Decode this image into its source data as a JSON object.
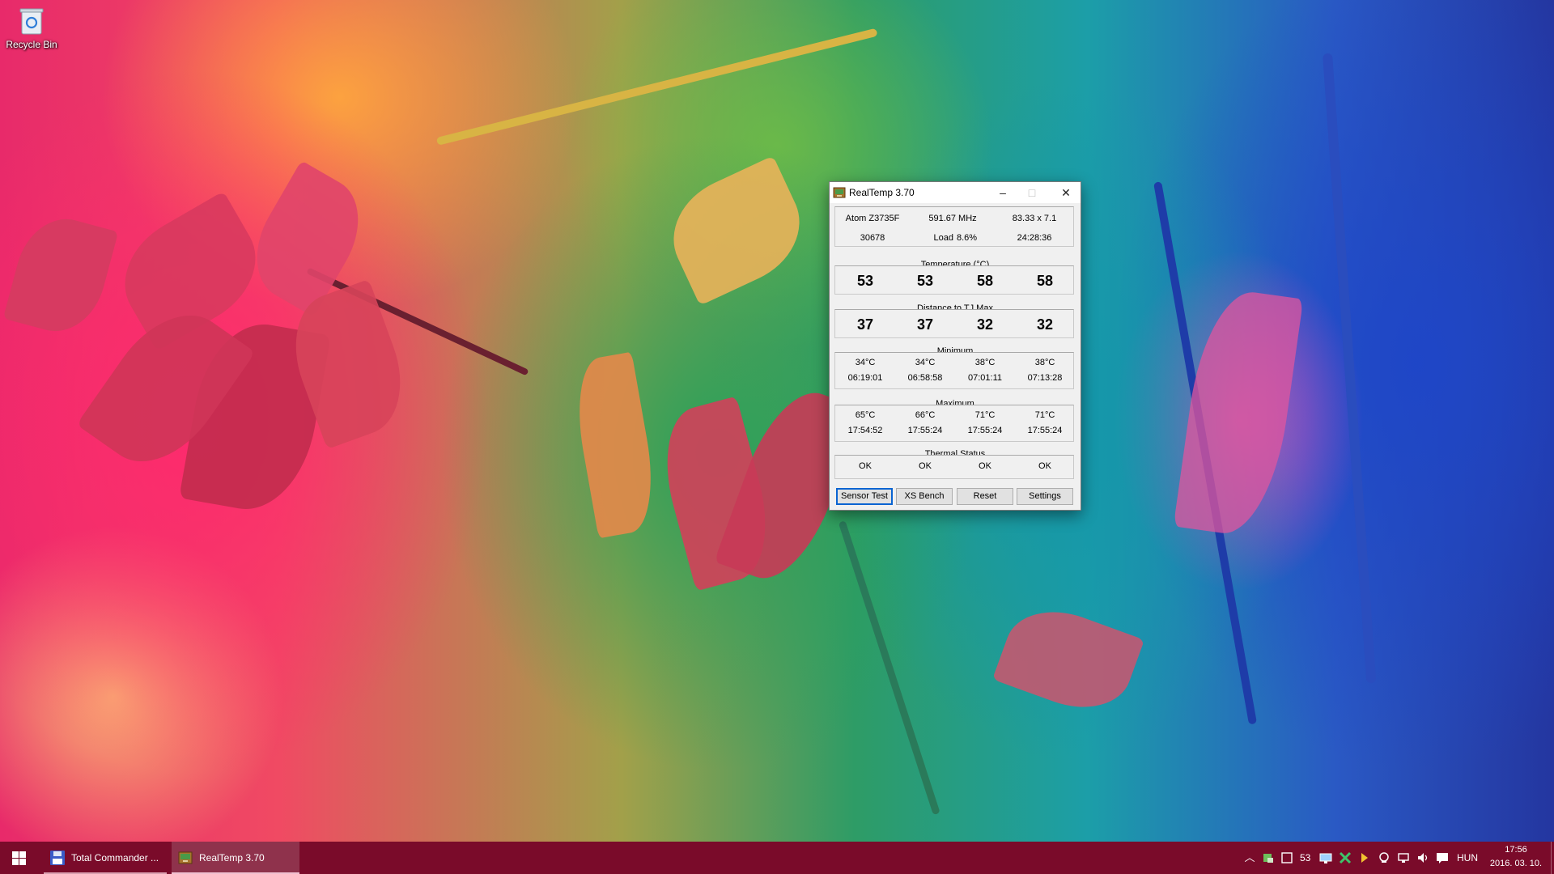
{
  "desktop": {
    "icons": [
      {
        "label": "Recycle Bin",
        "icon": "recycle-bin-icon"
      }
    ]
  },
  "window": {
    "title": "RealTemp 3.70",
    "controls": {
      "minimize": "–",
      "maximize": "□",
      "close": "✕"
    },
    "cpu": {
      "model": "Atom Z3735F",
      "frequency": "591.67 MHz",
      "multiplier": "83.33 x 7.1",
      "vid": "30678",
      "load_label": "Load",
      "load_value": "8.6%",
      "uptime": "24:28:36"
    },
    "temperature": {
      "title": "Temperature (°C)",
      "values": [
        "53",
        "53",
        "58",
        "58"
      ]
    },
    "distance": {
      "title": "Distance to TJ Max",
      "values": [
        "37",
        "37",
        "32",
        "32"
      ]
    },
    "minimum": {
      "title": "Minimum",
      "temps": [
        "34°C",
        "34°C",
        "38°C",
        "38°C"
      ],
      "times": [
        "06:19:01",
        "06:58:58",
        "07:01:11",
        "07:13:28"
      ]
    },
    "maximum": {
      "title": "Maximum",
      "temps": [
        "65°C",
        "66°C",
        "71°C",
        "71°C"
      ],
      "times": [
        "17:54:52",
        "17:55:24",
        "17:55:24",
        "17:55:24"
      ]
    },
    "thermal_status": {
      "title": "Thermal Status",
      "values": [
        "OK",
        "OK",
        "OK",
        "OK"
      ]
    },
    "buttons": {
      "sensor_test": "Sensor Test",
      "xs_bench": "XS Bench",
      "reset": "Reset",
      "settings": "Settings"
    }
  },
  "taskbar": {
    "items": [
      {
        "label": "Total Commander ...",
        "icon": "floppy-disk-icon"
      },
      {
        "label": "RealTemp 3.70",
        "icon": "realtemp-icon"
      }
    ],
    "tray": {
      "temp_readout": "53",
      "language": "HUN",
      "time": "17:56",
      "date": "2016. 03. 10."
    }
  },
  "colors": {
    "taskbar": "#7a0b2a",
    "window_bg": "#f0f0f0",
    "focus_border": "#0a64d2"
  }
}
